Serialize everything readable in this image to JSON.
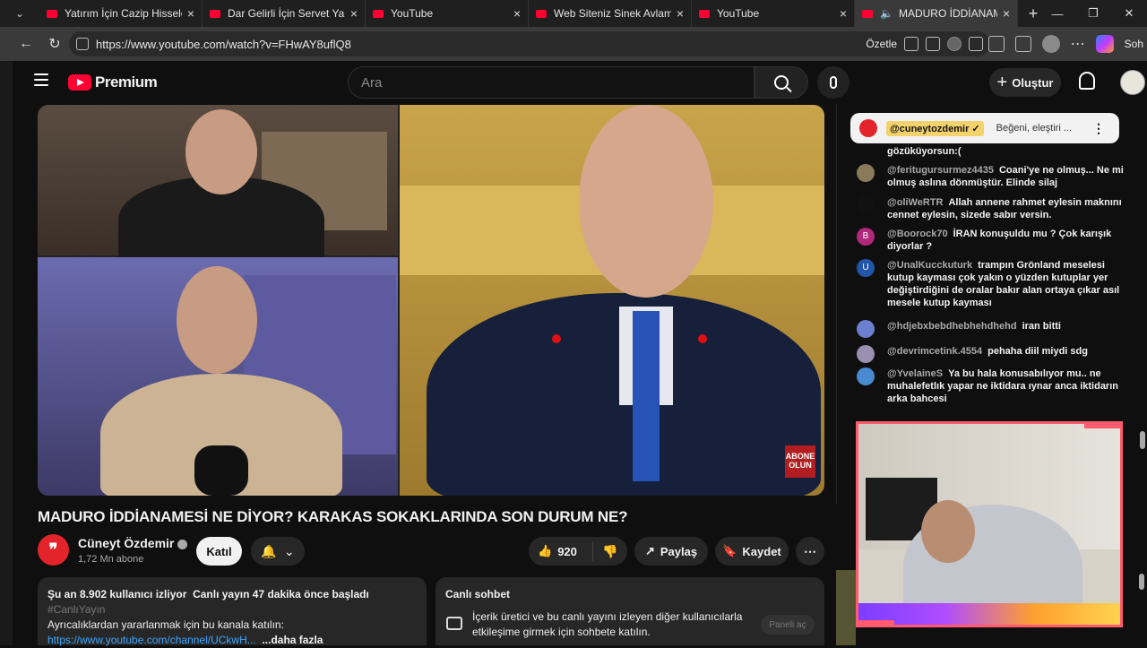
{
  "browser": {
    "tabs": [
      {
        "title": "Yatırım İçin Cazip Hisseler Oca",
        "active": false
      },
      {
        "title": "Dar Gelirli İçin Servet Yaratma",
        "active": false
      },
      {
        "title": "YouTube",
        "active": false
      },
      {
        "title": "Web Siteniz Sinek Avlamasını",
        "active": false
      },
      {
        "title": "YouTube",
        "active": false
      },
      {
        "title": "MADURO İDDİANAMESİ",
        "active": true
      }
    ],
    "url": "https://www.youtube.com/watch?v=FHwAY8uflQ8",
    "summarize_label": "Özetle",
    "copilot_label": "Soh"
  },
  "youtube": {
    "brand": "Premium",
    "search_placeholder": "Ara",
    "create_label": "Oluştur"
  },
  "video": {
    "title": "MADURO İDDİANAMESİ NE DİYOR? KARAKAS SOKAKLARINDA SON DURUM NE?",
    "subscribe_badge": "ABONE OLUN",
    "channel_name": "Cüneyt Özdemir",
    "subscribers": "1,72 Mn abone",
    "join_label": "Katıl",
    "likes": "920",
    "share_label": "Paylaş",
    "save_label": "Kaydet"
  },
  "description": {
    "watching": "Şu an 8.902 kullanıcı izliyor",
    "started": "Canlı yayın 47 dakika önce başladı",
    "hashtag": "#CanlıYayın",
    "perks": "Ayrıcalıklardan yararlanmak için bu kanala katılın:",
    "link": "https://www.youtube.com/channel/UCkwH...",
    "more": "...daha fazla"
  },
  "chat_panel": {
    "heading": "Canlı sohbet",
    "text": "İçerik üretici ve bu canlı yayını izleyen diğer kullanıcılarla etkileşime girmek için sohbete katılın.",
    "open_panel": "Paneli aç"
  },
  "live_chat": {
    "pinned_user": "@cuneytozdemir ✓",
    "pinned_text": "Beğeni, eleştiri ...",
    "messages": [
      {
        "user": "",
        "text": "gözüküyorsun:(",
        "color": "#0f0f0f"
      },
      {
        "user": "@feritugursurmez4435",
        "text": "Coani'ye ne olmuş... Ne mi olmuş aslına dönmüştür. Elinde silaj",
        "color": "#8a7a5a"
      },
      {
        "user": "@oliWeRTR",
        "text": "Allah annene rahmet eylesin maknını cennet eylesin, sizede sabır versin.",
        "color": "#111111"
      },
      {
        "user": "@Boorock70",
        "text": "İRAN konuşuldu mu ? Çok karışık diyorlar ?",
        "color": "#b0287a"
      },
      {
        "user": "@UnalKucckuturk",
        "text": "trampın Grönland meselesi kutup kayması çok yakın o yüzden kutuplar yer değiştirdiğini de oralar bakır alan ortaya çıkar asıl mesele kutup kayması",
        "color": "#2256a8"
      },
      {
        "user": "@hdjebxbebdhebhehdhehd",
        "text": "iran bitti",
        "color": "#6a7fcf"
      },
      {
        "user": "@devrimcetink.4554",
        "text": "pehaha diil miydi sdg",
        "color": "#9a8fb0"
      },
      {
        "user": "@YvelaineS",
        "text": "Ya bu hala konusabılıyor mu.. ne muhalefetlık yapar ne iktidara ıynar anca iktidarın arka bahcesi",
        "color": "#4a8ad0"
      }
    ],
    "avatar_letters": {
      "b": "B",
      "u": "U"
    }
  },
  "colors": {
    "accent": "#ff0033",
    "link": "#3ea6ff",
    "webcam_border": "#ff5a6e"
  }
}
